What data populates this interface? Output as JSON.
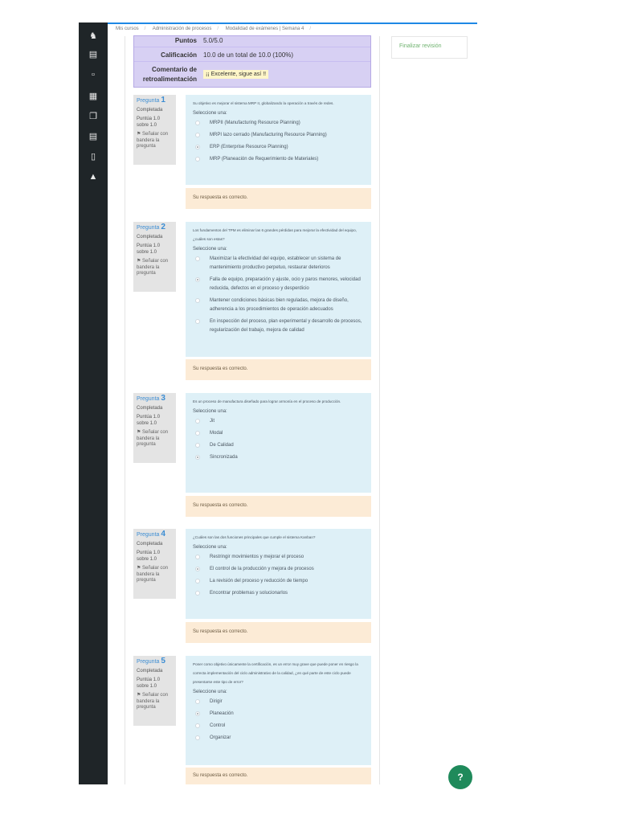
{
  "breadcrumb": [
    "Mis cursos",
    "Administración de procesos",
    "Modalidad de exámenes | Semana 4"
  ],
  "sidebar_icons": [
    "user-icon",
    "book-icon",
    "folder-icon",
    "calendar-icon",
    "file-icon",
    "book-open-icon",
    "phone-icon",
    "graduation-cap-icon"
  ],
  "summary": {
    "puntos_label": "Puntos",
    "puntos_value": "5.0/5.0",
    "calificacion_label": "Calificación",
    "calificacion_value": "10.0 de un total de 10.0 (100%)",
    "comentario_label": "Comentario de retroalimentación",
    "comentario_value": "¡¡ Excelente, sigue así !!"
  },
  "nav": {
    "finish_review": "Finalizar revisión"
  },
  "labels": {
    "pregunta": "Pregunta",
    "completada": "Completada",
    "puntua": "Puntúa 1.0 sobre 1.0",
    "flag": "Señalar con bandera la pregunta",
    "seleccione": "Seleccione una:",
    "correct": "Su respuesta es correcto."
  },
  "questions": [
    {
      "number": "1",
      "text": "Su objetivo es mejorar el sistema MRP II, globalizando la operación a través de redes.",
      "options": [
        "MRPII (Manufacturing Resource Planning)",
        "MRPI lazo cerrado (Manufacturing Resource Planning)",
        "ERP (Enterprise Resource Planning)",
        "MRP (Planeación de Requerimiento de Materiales)"
      ],
      "selected": 2
    },
    {
      "number": "2",
      "text": "Los fundamentos del TPM es eliminar las 6 grandes pérdidas para mejorar la efectividad del equipo, ¿cuáles son estas?",
      "options": [
        "Maximizar la efectividad del equipo, establecer un sistema de mantenimiento productivo perpetuo, restaurar deterioros",
        "Falla de equipo, preparación y ajuste, ocio y paros menores, velocidad reducida, defectos en el proceso y desperdicio",
        "Mantener condiciones básicas bien reguladas, mejora de diseño, adherencia a los procedimientos de operación adecuados",
        "En inspección del proceso, plan experimental y desarrollo de procesos, regularización del trabajo, mejora de calidad"
      ],
      "selected": 1
    },
    {
      "number": "3",
      "text": "Es un proceso de manufactura diseñado para lograr armonía en el proceso de producción.",
      "options": [
        "Jit",
        "Modal",
        "De Calidad",
        "Sincronizada"
      ],
      "selected": 3
    },
    {
      "number": "4",
      "text": "¿Cuáles son las dos funciones principales que cumple el sistema Kanban?",
      "options": [
        "Restringir movimientos y mejorar el proceso",
        "El control de la producción y mejora de procesos",
        "La revisión del proceso y reducción de tiempo",
        "Encontrar problemas y solucionarlos"
      ],
      "selected": 1
    },
    {
      "number": "5",
      "text": "Poner como objetivo únicamente la certificación, es un error muy grave que puede poner en riesgo la correcta implementación del ciclo administrativo de la calidad, ¿en qué parte de este ciclo puede presentarse este tipo de error?",
      "options": [
        "Dirigir",
        "Planeación",
        "Control",
        "Organizar"
      ],
      "selected": 1
    }
  ],
  "help_label": "?"
}
